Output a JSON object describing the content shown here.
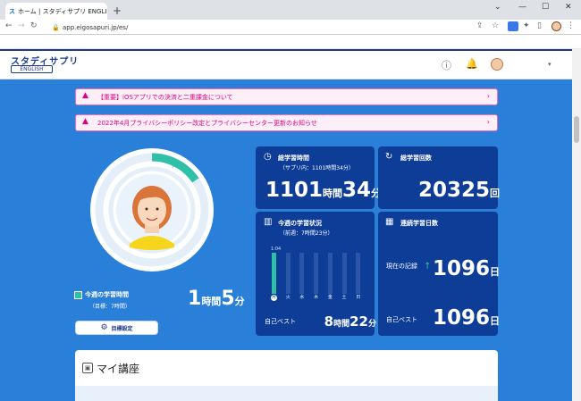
{
  "browser": {
    "tab_favicon": "ス",
    "tab_title": "ホーム | スタディサプリ ENGLISH",
    "tab_audio_icon": "speaker-icon",
    "tab_close": "×",
    "new_tab": "+",
    "url": "app.eigosapuri.jp/es/",
    "win_minimize": "—",
    "win_maximize": "☐",
    "win_close": "✕"
  },
  "header": {
    "logo": "スタディサプリ",
    "logo_sub": "ENGLISH"
  },
  "notices": [
    {
      "text": "【重要】iOSアプリでの決済と二重課金について"
    },
    {
      "text": "2022年4月プライバシーポリシー改定とプライバシーセンター更新のお知らせ"
    }
  ],
  "weekly": {
    "label": "今週の学習時間",
    "target": "（目標：7時間）",
    "hours": "1",
    "hours_unit": "時間",
    "minutes": "5",
    "minutes_unit": "分",
    "ring_label": "月",
    "progress_fraction": 0.155
  },
  "goal_button": "目標設定",
  "total_time": {
    "title": "総学習時間",
    "sub": "（サプリ内：1101時間34分）",
    "hours": "1101",
    "hours_unit": "時間",
    "minutes": "34",
    "minutes_unit": "分"
  },
  "total_count": {
    "title": "総学習回数",
    "value": "20325",
    "unit": "回"
  },
  "week_status": {
    "title": "今週の学習状況",
    "sub": "（前週：7時間23分）",
    "y_label": "1:04",
    "days": [
      "月",
      "火",
      "水",
      "木",
      "金",
      "土",
      "日"
    ],
    "values": [
      1.0,
      0,
      0,
      0,
      0,
      0,
      0
    ],
    "best_label": "自己ベスト",
    "best_hours": "8",
    "best_hours_unit": "時間",
    "best_minutes": "22",
    "best_minutes_unit": "分"
  },
  "streak": {
    "title": "連続学習日数",
    "current_label": "現在の記録",
    "current_value": "1096",
    "unit": "日",
    "best_label": "自己ベスト",
    "best_value": "1096"
  },
  "my_course": {
    "title": "マイ講座"
  },
  "colors": {
    "accent": "#2fc0a7",
    "card": "#0e3d97",
    "bg": "#2a80d9",
    "notice": "#e0007d"
  }
}
